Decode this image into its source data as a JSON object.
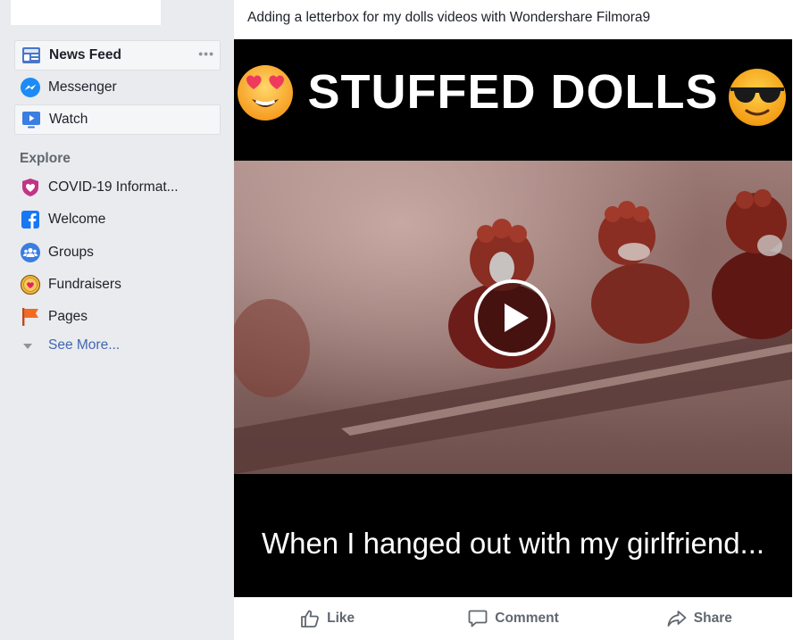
{
  "sidebar": {
    "items": [
      {
        "label": "News Feed",
        "icon": "news-feed-icon",
        "active": true
      },
      {
        "label": "Messenger",
        "icon": "messenger-icon"
      },
      {
        "label": "Watch",
        "icon": "watch-icon",
        "active": true
      }
    ],
    "more_dots": "•••",
    "explore": {
      "header": "Explore",
      "items": [
        {
          "label": "COVID-19 Informat...",
          "icon": "covid-heart-icon"
        },
        {
          "label": "Welcome",
          "icon": "facebook-icon"
        },
        {
          "label": "Groups",
          "icon": "groups-icon"
        },
        {
          "label": "Fundraisers",
          "icon": "fundraisers-icon"
        },
        {
          "label": "Pages",
          "icon": "flag-icon"
        }
      ],
      "see_more": "See More..."
    }
  },
  "post": {
    "text": "Adding a letterbox for my dolls videos with Wondershare Filmora9",
    "video": {
      "title": "STUFFED DOLLS",
      "subtitle": "When I hanged out with my girlfriend...",
      "emoji_left": "heart-eyes-emoji",
      "emoji_right": "sunglasses-emoji"
    },
    "actions": {
      "like": "Like",
      "comment": "Comment",
      "share": "Share"
    }
  },
  "colors": {
    "sidebar_bg": "#e9ebee",
    "link_blue": "#4267b2",
    "facebook_blue": "#1877f2",
    "action_grey": "#606770"
  }
}
